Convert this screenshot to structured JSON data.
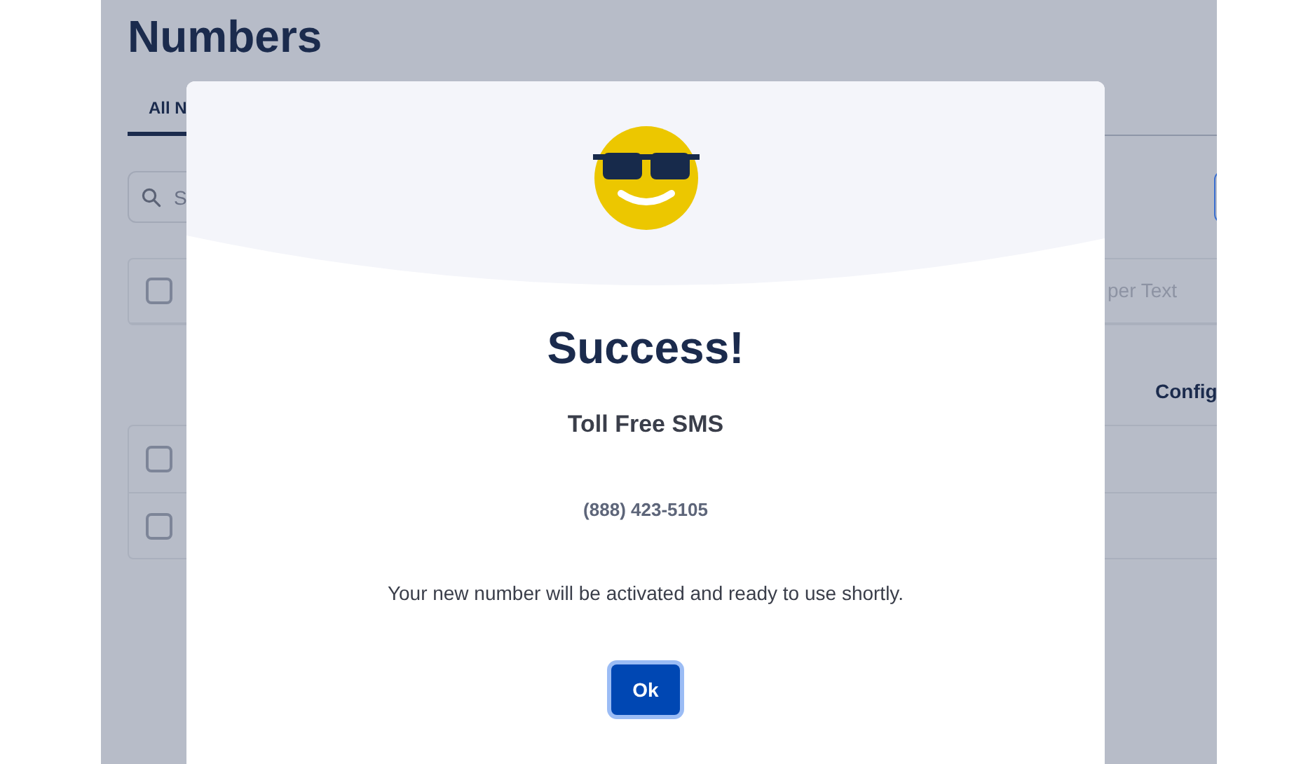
{
  "page": {
    "title": "Numbers",
    "tabs": [
      {
        "label": "All N",
        "selected": true
      }
    ],
    "search": {
      "placeholder": "S"
    },
    "table": {
      "select_all": {
        "checked": false
      },
      "header_text": "per Text",
      "columns": [
        "Config"
      ],
      "rows": [
        {
          "checked": false
        },
        {
          "checked": false
        }
      ]
    }
  },
  "dialog": {
    "title": "Success!",
    "product": "Toll Free SMS",
    "number": "(888) 423-5105",
    "message": "Your new number will be activated and ready to use shortly.",
    "button": "Ok"
  }
}
